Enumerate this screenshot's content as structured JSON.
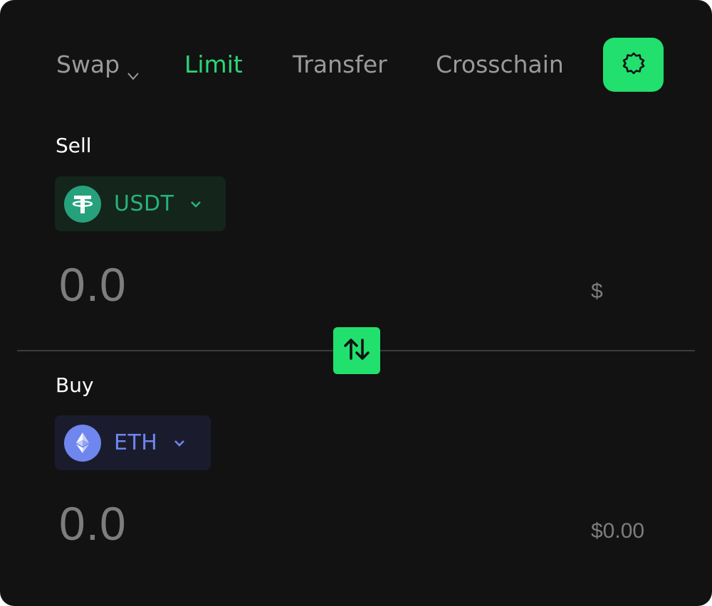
{
  "tabs": {
    "swap": "Swap",
    "limit": "Limit",
    "transfer": "Transfer",
    "crosschain": "Crosschain",
    "active": "Limit"
  },
  "colors": {
    "accent": "#22e06e",
    "active_tab": "#2bd675",
    "background": "#121212",
    "usdt": "#26a17b",
    "eth": "#6f86ee"
  },
  "icons": {
    "settings": "gear-icon",
    "swap_direction": "swap-arrows-icon",
    "tab_dropdown": "chevron-down-icon"
  },
  "sell": {
    "label": "Sell",
    "token": "USDT",
    "token_icon": "tether-icon",
    "amount": "0.0",
    "usd": "$"
  },
  "buy": {
    "label": "Buy",
    "token": "ETH",
    "token_icon": "ethereum-icon",
    "amount": "0.0",
    "usd": "$0.00"
  }
}
